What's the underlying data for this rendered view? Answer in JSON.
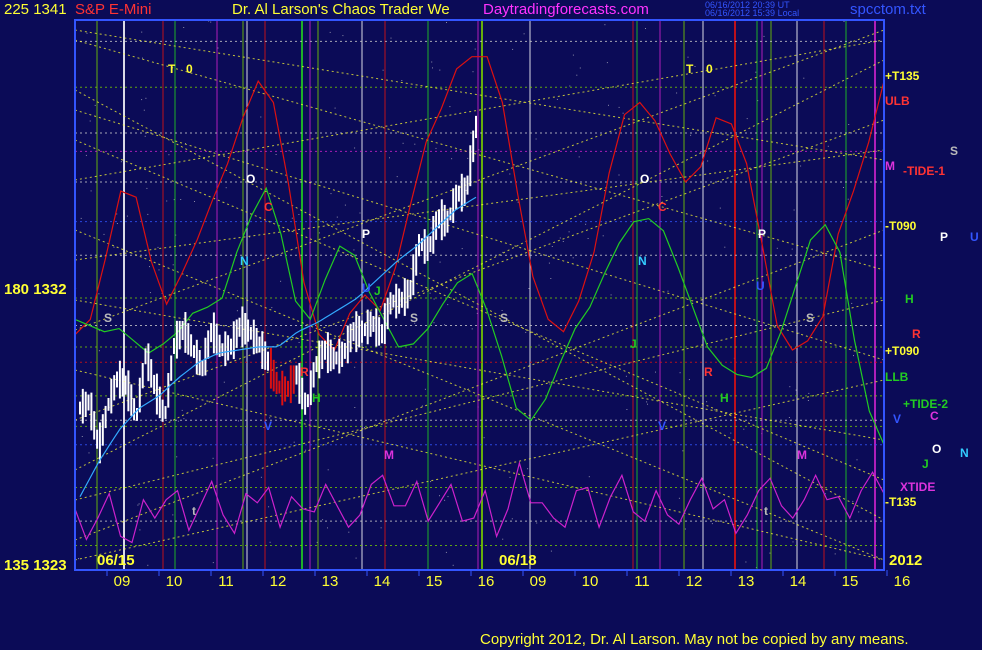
{
  "header": {
    "left_axis_top": "225  1341",
    "instrument": "S&P E-Mini",
    "title": "Dr. Al Larson's Chaos Trader We",
    "site": "Daytradingforecasts.com",
    "timestamp_ut": "06/16/2012 20:39 UT",
    "timestamp_local": "06/16/2012 15:39 Local",
    "filename": "spcctom.txt"
  },
  "footer": {
    "copyright": "Copyright 2012, Dr. Al Larson. May not be copied by any means."
  },
  "colors": {
    "background": "#0b0b57",
    "frame": "#3355ff",
    "price_bars": "#ffffff",
    "green_line": "#22cc22",
    "red_line": "#dd1111",
    "magenta_line": "#cc22cc",
    "cyan_line": "#33aaff",
    "grid_vertical": "#77cc00",
    "dotted_yellow": "#ffff33",
    "label_yellow": "#ffff33",
    "label_red": "#ff3333"
  },
  "chart_data": {
    "type": "bar",
    "instrument": "S&P E-Mini",
    "ylim": [
      1323,
      1341
    ],
    "left_axis_labels": [
      {
        "angle": "225",
        "price": "1341"
      },
      {
        "angle": "180",
        "price": "1332"
      },
      {
        "angle": "135",
        "price": "1323"
      }
    ],
    "date_labels": [
      "06/15",
      "06/18"
    ],
    "year_label": "2012",
    "x_tick_labels": [
      "09",
      "10",
      "11",
      "12",
      "13",
      "14",
      "15",
      "16",
      "09",
      "10",
      "11",
      "12",
      "13",
      "14",
      "15",
      "16"
    ],
    "right_labels": [
      {
        "text": "+T135",
        "color": "#ffff33"
      },
      {
        "text": "ULB",
        "color": "#ff3333"
      },
      {
        "text": "M",
        "color": "#dd33dd"
      },
      {
        "text": "-TIDE-1",
        "color": "#ff3333"
      },
      {
        "text": "S",
        "color": "#bbbbbb"
      },
      {
        "text": "-T090",
        "color": "#ffff33"
      },
      {
        "text": "P",
        "color": "#ffffff"
      },
      {
        "text": "U",
        "color": "#3355ff"
      },
      {
        "text": "H",
        "color": "#22cc22"
      },
      {
        "text": "R",
        "color": "#ff3333"
      },
      {
        "text": "+T090",
        "color": "#ffff33"
      },
      {
        "text": "LLB",
        "color": "#22cc22"
      },
      {
        "text": "+TIDE-2",
        "color": "#22cc22"
      },
      {
        "text": "V",
        "color": "#3355ff"
      },
      {
        "text": "C",
        "color": "#dd33dd"
      },
      {
        "text": "O",
        "color": "#ffffff"
      },
      {
        "text": "N",
        "color": "#33ccff"
      },
      {
        "text": "J",
        "color": "#22cc22"
      },
      {
        "text": "XTIDE",
        "color": "#dd33dd"
      },
      {
        "text": "-T135",
        "color": "#ffff33"
      }
    ],
    "flux_markers": [
      {
        "text": "T",
        "color": "#ffff33"
      },
      {
        "text": "0",
        "color": "#ffff33"
      },
      {
        "text": "T",
        "color": "#ffff33"
      },
      {
        "text": "0",
        "color": "#ffff33"
      },
      {
        "text": "O",
        "color": "#ffffff"
      },
      {
        "text": "O",
        "color": "#ffffff"
      },
      {
        "text": "C",
        "color": "#ff3333"
      },
      {
        "text": "C",
        "color": "#ff3333"
      },
      {
        "text": "N",
        "color": "#33ccff"
      },
      {
        "text": "N",
        "color": "#33ccff"
      },
      {
        "text": "P",
        "color": "#ffffff"
      },
      {
        "text": "P",
        "color": "#ffffff"
      },
      {
        "text": "S",
        "color": "#bbbbbb"
      },
      {
        "text": "S",
        "color": "#bbbbbb"
      },
      {
        "text": "S",
        "color": "#bbbbbb"
      },
      {
        "text": "S",
        "color": "#bbbbbb"
      },
      {
        "text": "V",
        "color": "#3355ff"
      },
      {
        "text": "V",
        "color": "#3355ff"
      },
      {
        "text": "M",
        "color": "#dd33dd"
      },
      {
        "text": "M",
        "color": "#dd33dd"
      },
      {
        "text": "R",
        "color": "#ff3333"
      },
      {
        "text": "R",
        "color": "#ff3333"
      },
      {
        "text": "H",
        "color": "#22cc22"
      },
      {
        "text": "H",
        "color": "#22cc22"
      },
      {
        "text": "J",
        "color": "#22cc22"
      },
      {
        "text": "J",
        "color": "#22cc22"
      },
      {
        "text": "U",
        "color": "#3355ff"
      },
      {
        "text": "U",
        "color": "#3355ff"
      },
      {
        "text": "t",
        "color": "#bbbbbb"
      },
      {
        "text": "t",
        "color": "#bbbbbb"
      }
    ],
    "price_series": {
      "name": "S&P E-Mini",
      "bar_count": 140,
      "anchors": [
        1328.3,
        1328.5,
        1327.0,
        1328.4,
        1329.3,
        1329.0,
        1328.0,
        1330.1,
        1328.9,
        1328.0,
        1330.4,
        1330.9,
        1330.2,
        1329.6,
        1330.9,
        1330.2,
        1330.3,
        1331.0,
        1330.8,
        1330.4,
        1329.8,
        1329.0,
        1328.9,
        1329.4,
        1328.3,
        1329.7,
        1330.2,
        1329.9,
        1330.1,
        1330.8,
        1330.8,
        1331.1,
        1330.7,
        1331.8,
        1331.8,
        1332.1,
        1333.7,
        1333.5,
        1334.5,
        1334.4,
        1335.3,
        1335.4,
        1337.5
      ],
      "bar_range_low": 0.35,
      "bar_range_high": 1.2
    },
    "moving_average_anchors": [
      1325.4,
      1326.6,
      1327.6,
      1328.3,
      1328.7,
      1329.3,
      1329.8,
      1330.1,
      1330.2,
      1330.3,
      1330.3,
      1330.8,
      1331.1,
      1331.5,
      1331.9,
      1332.5,
      1333.1,
      1333.6,
      1334.2,
      1334.8,
      1335.2
    ],
    "forecast_lines": [
      {
        "name": "ULB",
        "color": "#dd1111",
        "values": [
          1330.7,
          1331.2,
          1333.2,
          1335.4,
          1335.2,
          1333.1,
          1331.7,
          1332.7,
          1333.8,
          1335.1,
          1336.3,
          1337.8,
          1339.0,
          1338.3,
          1335.6,
          1332.4,
          1330.7,
          1330.2,
          1331.4,
          1332.0,
          1331.5,
          1332.9,
          1335.0,
          1337.0,
          1338.1,
          1339.4,
          1339.8,
          1339.8,
          1338.3,
          1335.3,
          1332.6,
          1331.2,
          1330.8,
          1331.8,
          1333.4,
          1336.0,
          1337.9,
          1338.3,
          1337.7,
          1336.6,
          1335.7,
          1336.2,
          1337.8,
          1337.6,
          1336.3,
          1333.7,
          1331.0,
          1330.2,
          1330.5,
          1331.3,
          1334.0,
          1335.4,
          1337.0,
          1339.0
        ]
      },
      {
        "name": "LLB",
        "color": "#22cc22",
        "values": [
          1331.2,
          1331.0,
          1330.8,
          1330.9,
          1330.5,
          1330.1,
          1330.4,
          1330.8,
          1331.4,
          1331.6,
          1331.9,
          1333.4,
          1334.6,
          1335.5,
          1334.0,
          1331.8,
          1331.2,
          1332.5,
          1333.6,
          1333.3,
          1332.1,
          1331.2,
          1330.3,
          1330.4,
          1330.9,
          1331.7,
          1332.4,
          1332.7,
          1331.5,
          1330.0,
          1328.3,
          1327.9,
          1328.6,
          1329.8,
          1330.9,
          1331.6,
          1332.7,
          1333.7,
          1334.4,
          1334.5,
          1334.1,
          1332.9,
          1331.6,
          1330.3,
          1329.7,
          1329.4,
          1329.3,
          1329.6,
          1330.8,
          1332.3,
          1333.8,
          1334.3,
          1333.4,
          1330.5,
          1328.2,
          1327.1
        ]
      },
      {
        "name": "XTIDE",
        "color": "#cc22cc",
        "values": [
          1325.0,
          1324.0,
          1324.7,
          1325.5,
          1324.1,
          1323.9,
          1325.3,
          1324.7,
          1325.3,
          1325.6,
          1324.3,
          1325.1,
          1325.9,
          1324.8,
          1324.2,
          1325.5,
          1325.2,
          1325.7,
          1324.4,
          1325.4,
          1325.0,
          1324.9,
          1325.8,
          1325.1,
          1324.4,
          1324.8,
          1325.8,
          1326.1,
          1325.1,
          1325.1,
          1325.9,
          1324.6,
          1325.2,
          1325.8,
          1324.6,
          1324.7,
          1325.6,
          1324.1,
          1325.0,
          1326.5,
          1325.2,
          1325.2,
          1324.7,
          1324.4,
          1325.6,
          1325.7,
          1324.4,
          1325.4,
          1326.1,
          1324.9,
          1324.6,
          1325.6,
          1324.8,
          1324.5,
          1325.3,
          1326.0,
          1325.0,
          1325.3,
          1324.2,
          1324.8,
          1325.6,
          1326.0,
          1325.1,
          1324.7,
          1325.3,
          1326.1,
          1325.3,
          1325.4,
          1324.7,
          1325.6,
          1326.2,
          1325.5
        ]
      }
    ]
  }
}
